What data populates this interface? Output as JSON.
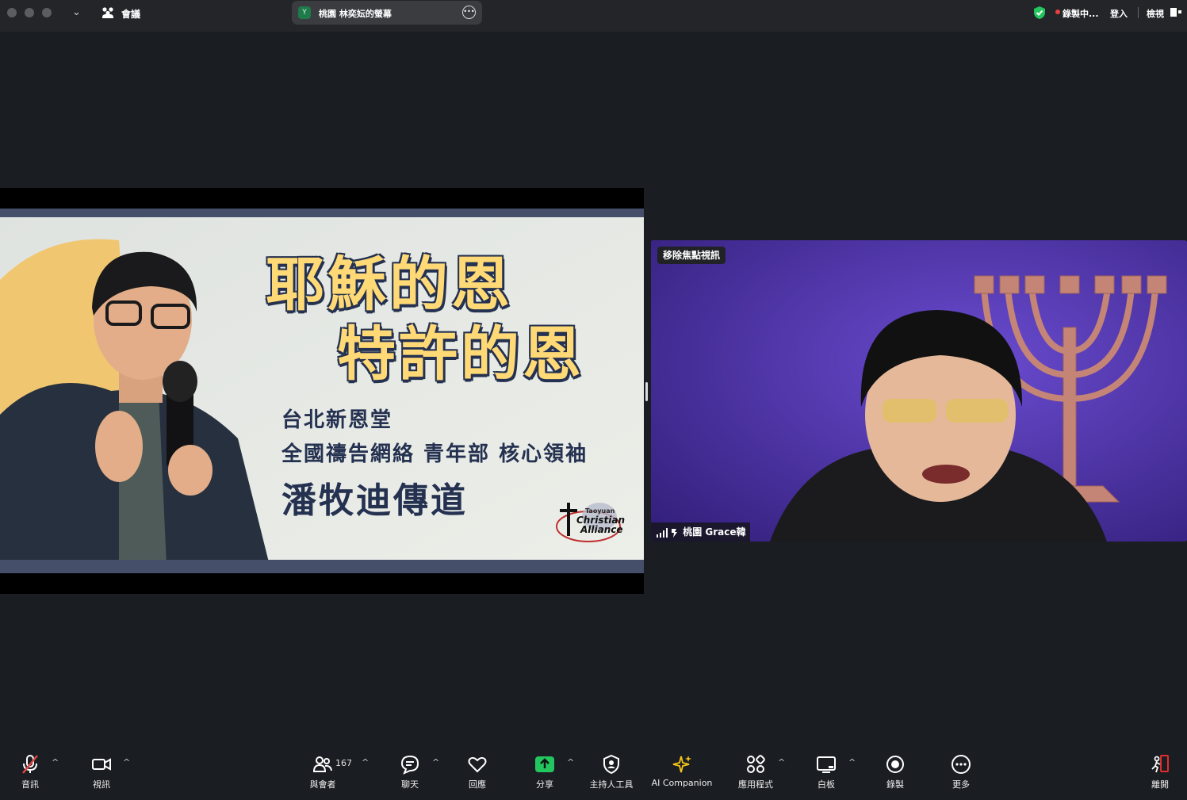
{
  "topbar": {
    "meeting_label": "會議",
    "share_avatar": "Y",
    "share_title": "桃園 林奕妘的螢幕",
    "recording_label": "錄製中...",
    "login_label": "登入",
    "view_label": "檢視"
  },
  "slide": {
    "title_line1": "耶穌的恩",
    "title_line2": "特許的恩",
    "line1": "台北新恩堂",
    "line2": "全國禱告網絡 青年部 核心領袖",
    "line3": "潘牧迪傳道",
    "logo_line1": "Taoyuan",
    "logo_line2": "Christian",
    "logo_line3": "Alliance"
  },
  "video": {
    "remove_spotlight_label": "移除焦點視訊",
    "participant_name": "桃園 Grace韓"
  },
  "toolbar": {
    "audio": "音訊",
    "video": "視訊",
    "participants": "與會者",
    "participant_count": "167",
    "chat": "聊天",
    "react": "回應",
    "share": "分享",
    "host_tools": "主持人工具",
    "ai_companion": "AI Companion",
    "apps": "應用程式",
    "whiteboard": "白板",
    "record": "錄製",
    "more": "更多",
    "leave": "離開"
  },
  "colors": {
    "share_green": "#23c55e",
    "leave_red": "#e02e2e",
    "mute_red": "#e04545",
    "ai_yellow": "#f5c518",
    "camera_bg": "#4a2fa6"
  }
}
